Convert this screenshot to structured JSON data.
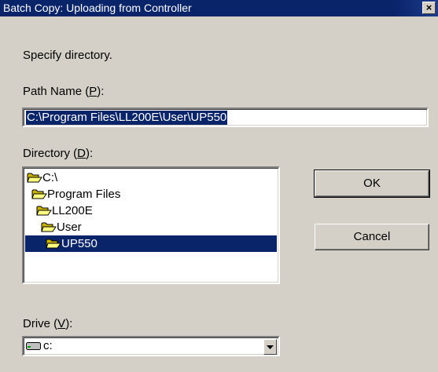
{
  "window": {
    "title": "Batch Copy: Uploading from Controller",
    "close_glyph": "×"
  },
  "instruction": "Specify directory.",
  "path_name": {
    "label_pre": "Path Name (",
    "label_key": "P",
    "label_post": "):",
    "value": "C:\\Program Files\\LL200E\\User\\UP550"
  },
  "directory": {
    "label_pre": "Directory (",
    "label_key": "D",
    "label_post": "):",
    "items": [
      {
        "label": "C:\\",
        "icon": "open-folder-icon"
      },
      {
        "label": "Program Files",
        "icon": "open-folder-icon"
      },
      {
        "label": "LL200E",
        "icon": "open-folder-icon"
      },
      {
        "label": "User",
        "icon": "open-folder-icon"
      },
      {
        "label": "UP550",
        "icon": "open-folder-icon",
        "selected": true
      }
    ]
  },
  "buttons": {
    "ok": "OK",
    "cancel": "Cancel"
  },
  "drive": {
    "label_pre": "Drive (",
    "label_key": "V",
    "label_post": "):",
    "value": "c:",
    "icon": "drive-icon"
  },
  "colors": {
    "face": "#d4d0c8",
    "selection": "#0a246a",
    "titlebar": "#0a246a"
  }
}
